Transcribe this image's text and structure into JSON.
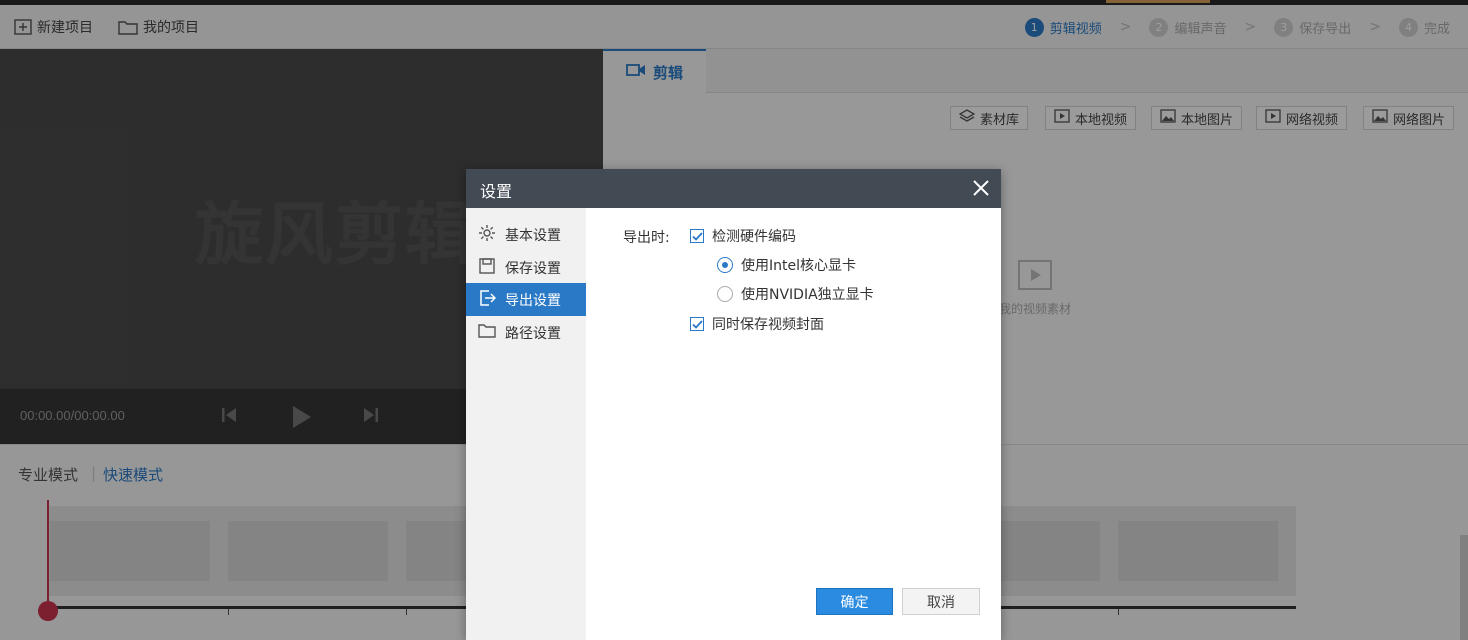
{
  "toolbar": {
    "new_project": "新建项目",
    "my_projects": "我的项目"
  },
  "steps": [
    {
      "num": "1",
      "label": "剪辑视频",
      "active": true
    },
    {
      "num": "2",
      "label": "编辑声音",
      "active": false
    },
    {
      "num": "3",
      "label": "保存导出",
      "active": false
    },
    {
      "num": "4",
      "label": "完成",
      "active": false
    }
  ],
  "preview": {
    "watermark": "旋风剪辑",
    "time": "00:00.00/00:00.00"
  },
  "panel": {
    "tab": "剪辑",
    "sources": [
      "素材库",
      "本地视频",
      "本地图片",
      "网络视频",
      "网络图片"
    ],
    "empty_hint": "我的视频素材"
  },
  "timeline": {
    "mode_pro": "专业模式",
    "mode_fast": "快速模式"
  },
  "dialog": {
    "title": "设置",
    "nav": [
      "基本设置",
      "保存设置",
      "导出设置",
      "路径设置"
    ],
    "active_nav": "导出设置",
    "export_label": "导出时:",
    "options": {
      "detect_hw": "检测硬件编码",
      "use_intel": "使用Intel核心显卡",
      "use_nvidia": "使用NVIDIA独立显卡",
      "save_cover": "同时保存视频封面"
    },
    "ok": "确定",
    "cancel": "取消"
  },
  "colors": {
    "accent": "#2a79c6",
    "title_bar": "#424a54",
    "playhead": "#c8334c"
  }
}
